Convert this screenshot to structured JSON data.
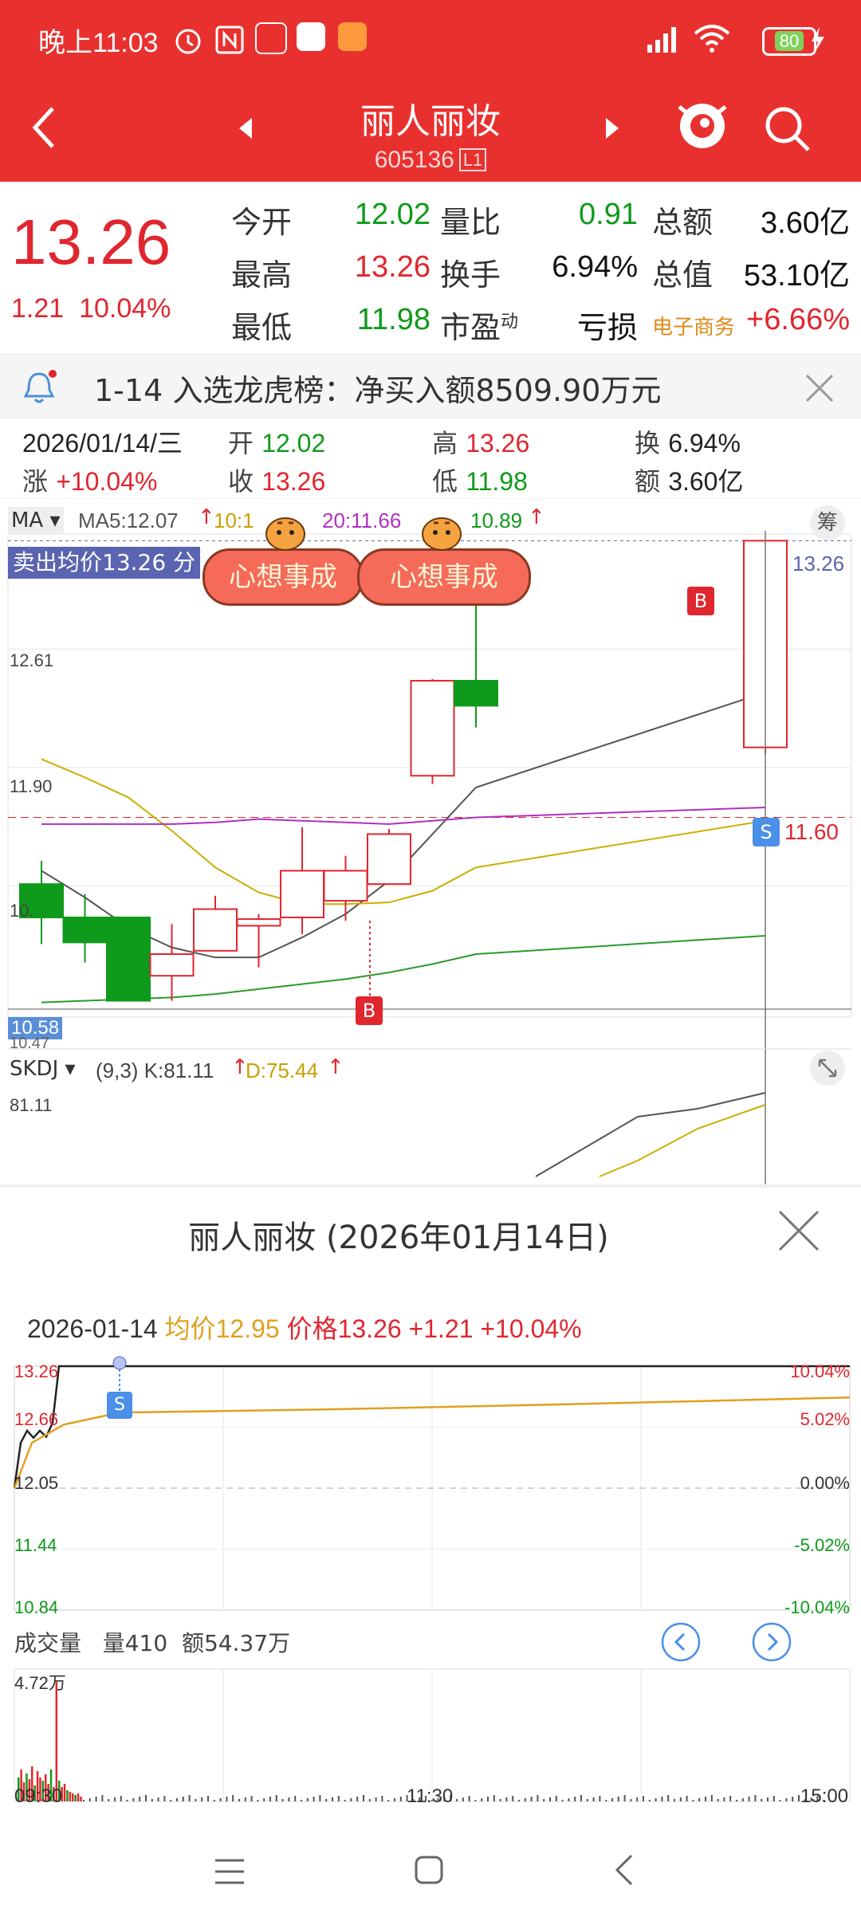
{
  "status_bar": {
    "time": "晚上11:03",
    "battery": "80"
  },
  "header": {
    "title": "丽人丽妆",
    "code": "605136",
    "level": "L1"
  },
  "quote": {
    "price": "13.26",
    "change": "1.21",
    "change_pct": "10.04%",
    "rows": [
      {
        "l1": "今开",
        "v1": "12.02",
        "l2": "量比",
        "v2": "0.91",
        "l3": "总额",
        "v3": "3.60亿"
      },
      {
        "l1": "最高",
        "v1": "13.26",
        "l2": "换手",
        "v2": "6.94%",
        "l3": "总值",
        "v3": "53.10亿"
      },
      {
        "l1": "最低",
        "v1": "11.98",
        "l2": "市盈",
        "l2_sup": "动",
        "v2": "亏损",
        "l3": "电子商务",
        "v3": "+6.66%"
      }
    ]
  },
  "notice": {
    "text": "1-14 入选龙虎榜：净买入额8509.90万元"
  },
  "day_info": {
    "date": "2026/01/14/三",
    "open_label": "开",
    "open": "12.02",
    "high_label": "高",
    "high": "13.26",
    "turnover_label": "换",
    "turnover": "6.94%",
    "rise_label": "涨",
    "rise": "+10.04%",
    "close_label": "收",
    "close": "13.26",
    "low_label": "低",
    "low": "11.98",
    "amount_label": "额",
    "amount": "3.60亿"
  },
  "kline": {
    "ma_selector": "MA",
    "ma5": "MA5:12.07",
    "ma10": "10:1",
    "ma20": "20:11.66",
    "ma30": "10.89",
    "chip_button": "筹",
    "sell_avg": "卖出均价13.26 分",
    "sticker_text": "心想事成",
    "price_labels": {
      "top": "13.26",
      "p1": "12.61",
      "p2": "11.90",
      "p3": "10.",
      "bottom_highlight": "10.58",
      "bottom": "10.47",
      "sell_line": "11.60"
    },
    "marker_b": "B",
    "marker_s": "S",
    "candles": [
      {
        "o": 11.2,
        "c": 11.0,
        "h": 11.34,
        "l": 10.84
      },
      {
        "o": 11.0,
        "c": 10.85,
        "h": 11.14,
        "l": 10.73
      },
      {
        "o": 11.0,
        "c": 10.5,
        "h": 11.0,
        "l": 10.5
      },
      {
        "o": 10.65,
        "c": 10.78,
        "h": 10.96,
        "l": 10.5
      },
      {
        "o": 10.8,
        "c": 11.05,
        "h": 11.13,
        "l": 10.8
      },
      {
        "o": 10.95,
        "c": 10.99,
        "h": 11.02,
        "l": 10.7
      },
      {
        "o": 11.0,
        "c": 11.28,
        "h": 11.54,
        "l": 10.9
      },
      {
        "o": 11.1,
        "c": 11.28,
        "h": 11.37,
        "l": 10.98
      },
      {
        "o": 11.2,
        "c": 11.5,
        "h": 11.53,
        "l": 11.2
      },
      {
        "o": 11.85,
        "c": 12.42,
        "h": 12.43,
        "l": 11.8
      },
      {
        "o": 12.42,
        "c": 12.27,
        "h": 12.9,
        "l": 12.14
      },
      {
        "o": 12.02,
        "c": 13.26,
        "h": 13.26,
        "l": 11.98
      }
    ],
    "skdj_label": "SKDJ",
    "skdj_params": "(9,3)",
    "skdj_k": "K:81.11",
    "skdj_d": "D:75.44",
    "skdj_top": "81.11"
  },
  "popup": {
    "title": "丽人丽妆 (2026年01月14日)",
    "date": "2026-01-14",
    "avg_label": "均价",
    "avg": "12.95",
    "price_label": "价格",
    "price": "13.26",
    "change": "+1.21",
    "change_pct": "+10.04%",
    "y_left": [
      "13.26",
      "12.66",
      "12.05",
      "11.44",
      "10.84"
    ],
    "y_right": [
      "10.04%",
      "5.02%",
      "0.00%",
      "-5.02%",
      "-10.04%"
    ],
    "marker_s": "S",
    "volume_label": "成交量",
    "volume": "量410",
    "amount": "额54.37万",
    "vol_max": "4.72万",
    "times": [
      "09:30",
      "11:30",
      "15:00"
    ]
  },
  "colors": {
    "brand": "#e8312f",
    "up": "#e0262f",
    "down": "#0e9a1a",
    "avg": "#e0a020"
  }
}
